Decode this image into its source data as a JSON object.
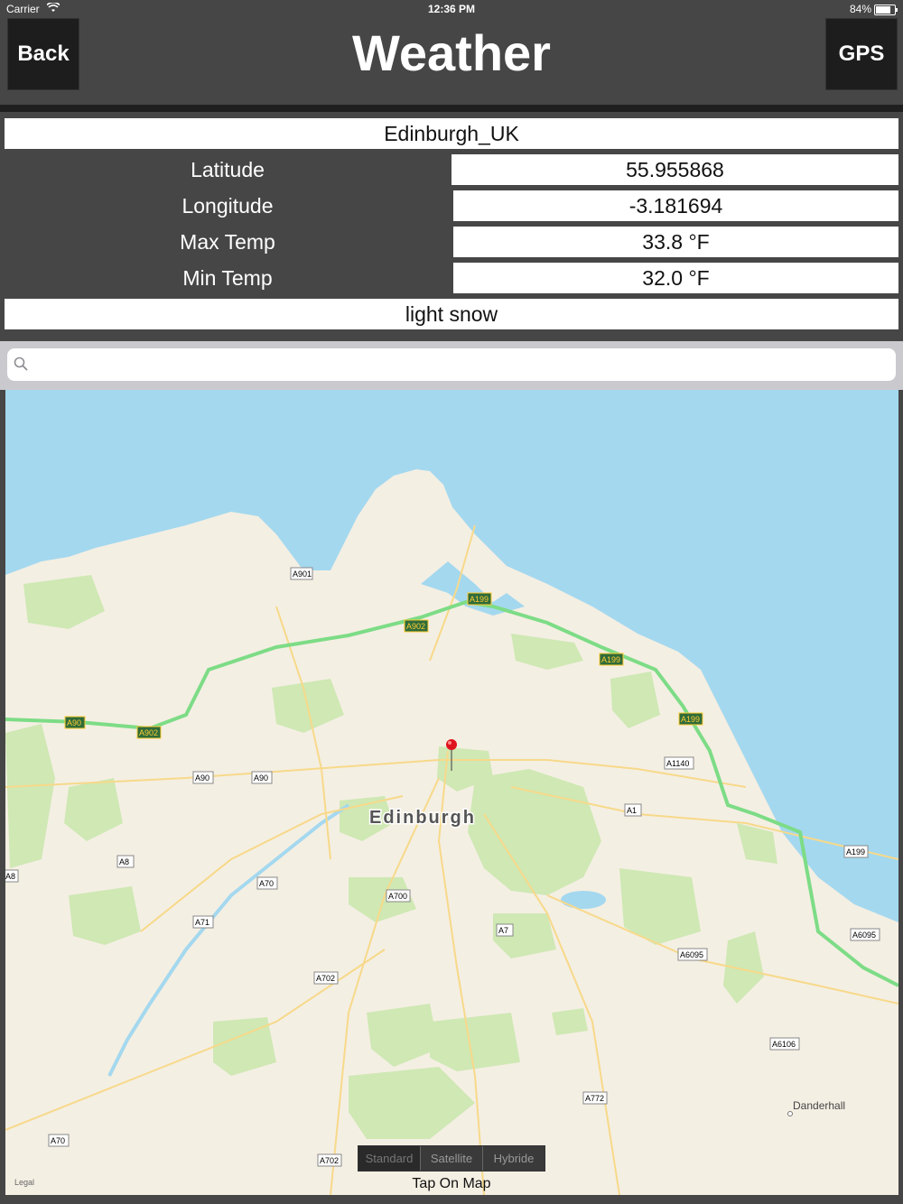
{
  "status": {
    "carrier": "Carrier",
    "time": "12:36 PM",
    "battery": "84%"
  },
  "header": {
    "back_label": "Back",
    "title": "Weather",
    "gps_label": "GPS"
  },
  "weather": {
    "location": "Edinburgh_UK",
    "rows": [
      {
        "label": "Latitude",
        "value": "55.955868"
      },
      {
        "label": "Longitude",
        "value": "-3.181694"
      },
      {
        "label": "Max Temp",
        "value": "33.8 °F"
      },
      {
        "label": "Min Temp",
        "value": "32.0 °F"
      }
    ],
    "description": "light snow"
  },
  "search": {
    "placeholder": ""
  },
  "map": {
    "city_label": "Edinburgh",
    "place_label": "Danderhall",
    "road_labels": [
      "A901",
      "A199",
      "A902",
      "A199",
      "A199",
      "A90",
      "A902",
      "A90",
      "A90",
      "A1140",
      "A1",
      "A8",
      "A70",
      "A700",
      "A199",
      "A71",
      "A7",
      "A6095",
      "A6095",
      "A702",
      "A6106",
      "A772",
      "A70",
      "A702",
      "A8"
    ],
    "legal": "Legal",
    "map_types": [
      "Standard",
      "Satellite",
      "Hybride"
    ],
    "selected_type": "Standard",
    "hint": "Tap On Map",
    "colors": {
      "water": "#a4d8ef",
      "land": "#f4efe3",
      "park": "#cfe8b4",
      "major_road": "#7ddc86",
      "pin": "#e0141e"
    }
  }
}
